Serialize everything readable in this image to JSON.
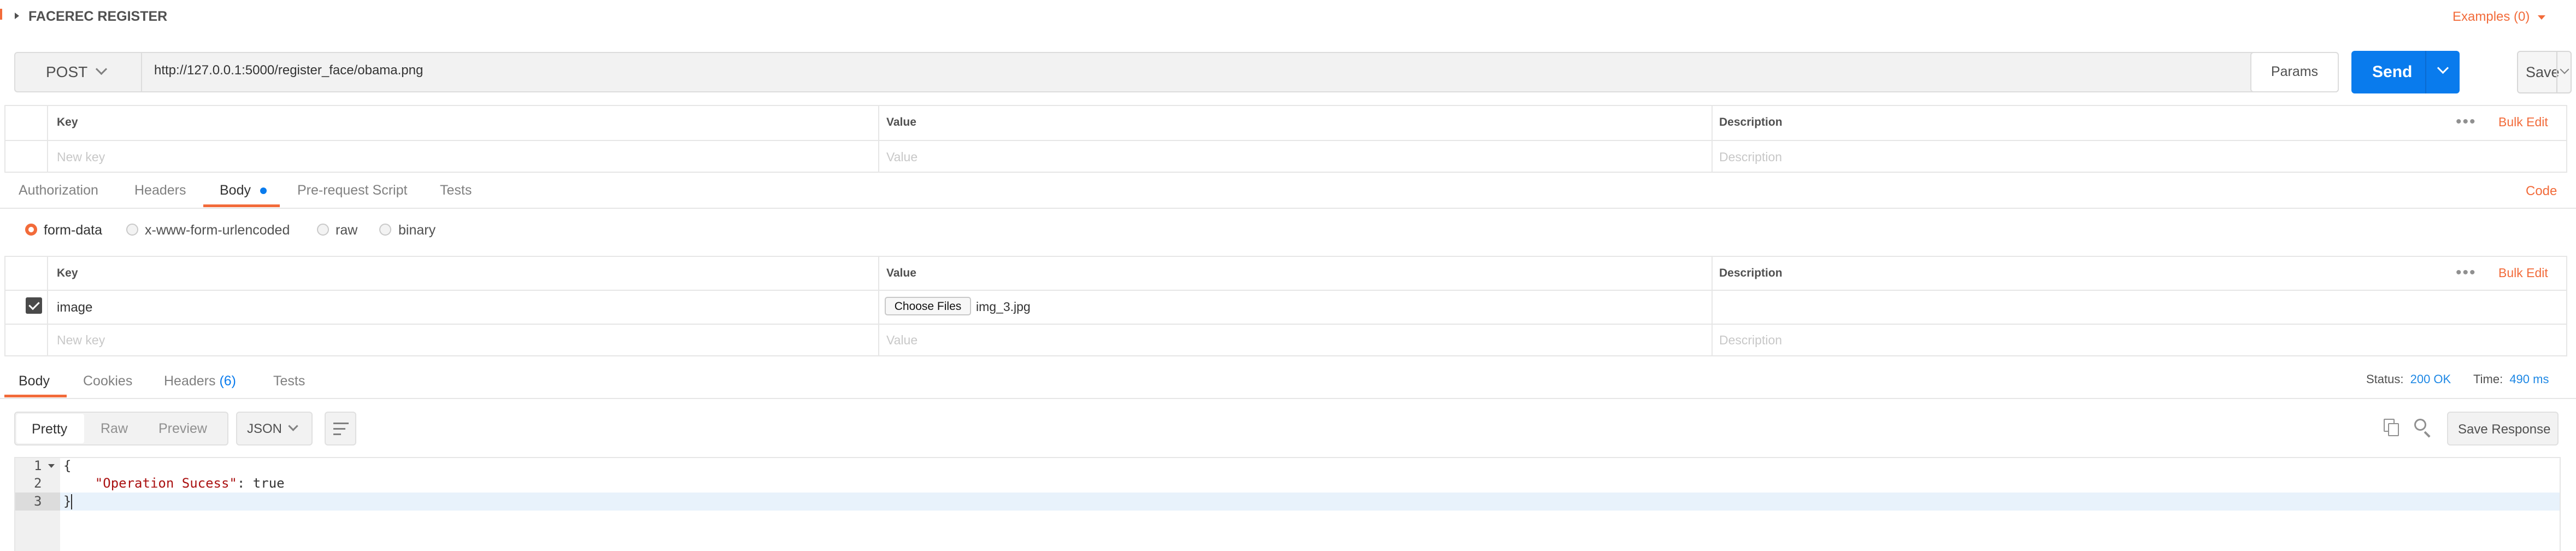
{
  "request": {
    "title": "FACEREC REGISTER",
    "examples_label": "Examples (0)",
    "method": "POST",
    "url": "http://127.0.0.1:5000/register_face/obama.png",
    "params_label": "Params",
    "send_label": "Send",
    "save_label": "Save"
  },
  "params_table": {
    "headers": [
      "Key",
      "Value",
      "Description"
    ],
    "bulk_edit": "Bulk Edit",
    "placeholder_row": [
      "New key",
      "Value",
      "Description"
    ]
  },
  "request_tabs": {
    "items": [
      "Authorization",
      "Headers",
      "Body",
      "Pre-request Script",
      "Tests"
    ],
    "active": "Body",
    "code_label": "Code"
  },
  "body_types": {
    "options": [
      "form-data",
      "x-www-form-urlencoded",
      "raw",
      "binary"
    ],
    "selected": "form-data"
  },
  "body_table": {
    "headers": [
      "Key",
      "Value",
      "Description"
    ],
    "bulk_edit": "Bulk Edit",
    "rows": [
      {
        "checked": true,
        "key": "image",
        "choose_files": "Choose Files",
        "file": "img_3.jpg",
        "description": ""
      }
    ],
    "placeholder_row": [
      "New key",
      "Value",
      "Description"
    ]
  },
  "response": {
    "tabs": [
      "Body",
      "Cookies",
      "Headers",
      "Tests"
    ],
    "headers_count": "(6)",
    "active_tab": "Body",
    "status_label": "Status:",
    "status_value": "200 OK",
    "time_label": "Time:",
    "time_value": "490 ms",
    "view_modes": [
      "Pretty",
      "Raw",
      "Preview"
    ],
    "active_view": "Pretty",
    "format": "JSON",
    "save_response": "Save Response",
    "line_numbers": [
      "1",
      "2",
      "3"
    ],
    "code_lines": [
      "{",
      "    \"Operation Sucess\": true",
      "}"
    ],
    "json_key": "\"Operation Sucess\"",
    "json_value": "true"
  },
  "colors": {
    "accent": "#f26b3a",
    "send": "#097bed",
    "status": "#1e88e5"
  }
}
